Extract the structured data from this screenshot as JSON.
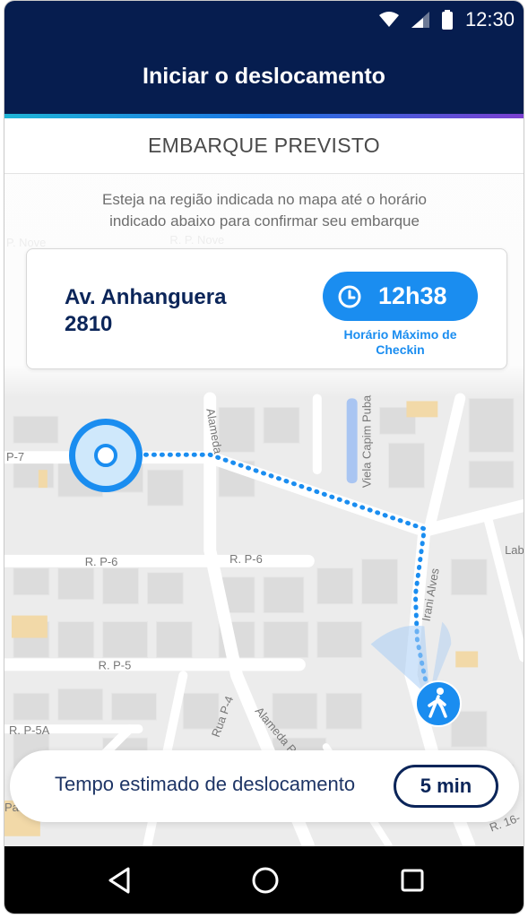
{
  "status_bar": {
    "time": "12:30"
  },
  "app_bar": {
    "title": "Iniciar o deslocamento"
  },
  "section": {
    "title": "EMBARQUE PREVISTO"
  },
  "instructions": {
    "line1": "Esteja na região indicada no mapa até o horário",
    "line2": "indicado abaixo para confirmar seu embarque"
  },
  "address_card": {
    "address_line1": "Av. Anhanguera",
    "address_line2": "2810",
    "checkin_time": "12h38",
    "checkin_caption_line1": "Horário Máximo de",
    "checkin_caption_line2": "Checkin"
  },
  "map": {
    "streets": [
      "R. P. Nove",
      "P. Nove",
      "P-7",
      "R. P-6",
      "R. P-6",
      "R. P-5",
      "R. P-5A",
      "Alameda",
      "Viela Capim Puba",
      "Rua P-4",
      "Alameda P",
      "R. 16-",
      "Lab",
      "Para",
      "Irani Alves"
    ]
  },
  "eta": {
    "label": "Tempo estimado de deslocamento",
    "value": "5 min"
  },
  "colors": {
    "header": "#061d4f",
    "accent_blue": "#1a8df0",
    "navy_text": "#0b2559"
  },
  "icons": {
    "clock": "clock-icon",
    "walker": "walking-person-icon",
    "origin": "origin-pin-icon"
  }
}
